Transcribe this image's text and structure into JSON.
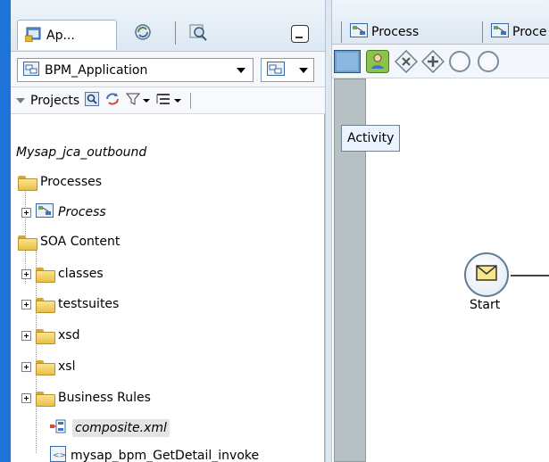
{
  "left_panel": {
    "tabs": {
      "applications_label": "Ap...",
      "icons": [
        "applications-icon",
        "resource-palette-icon",
        "search-resources-icon"
      ]
    },
    "app_selector": {
      "value": "BPM_Application"
    },
    "projects_toolbar": {
      "label": "Projects"
    },
    "tree": {
      "root": "Mysap_jca_outbound",
      "items": [
        {
          "label": "Processes",
          "icon": "folder-icon",
          "italic": false
        },
        {
          "label": "Process",
          "icon": "process-icon",
          "italic": true
        },
        {
          "label": "SOA Content",
          "icon": "folder-icon",
          "italic": false
        },
        {
          "label": "classes",
          "icon": "folder-icon",
          "italic": false
        },
        {
          "label": "testsuites",
          "icon": "folder-icon",
          "italic": false
        },
        {
          "label": "xsd",
          "icon": "folder-icon",
          "italic": false
        },
        {
          "label": "xsl",
          "icon": "folder-icon",
          "italic": false
        },
        {
          "label": "Business Rules",
          "icon": "folder-icon",
          "italic": false
        },
        {
          "label": "composite.xml",
          "icon": "composite-icon",
          "italic": true
        },
        {
          "label": "mysap_bpm_GetDetail_invoke",
          "icon": "wsdl-icon",
          "italic": false
        }
      ]
    }
  },
  "editor": {
    "tabs": [
      "Process",
      "Proce"
    ],
    "palette_icons": [
      "activity-icon",
      "user-task-icon",
      "exclusive-gateway-icon",
      "parallel-gateway-icon",
      "start-event-icon"
    ],
    "tooltip": "Activity",
    "start_event_label": "Start"
  },
  "colors": {
    "left_edge": "#1e73d8",
    "swimlane": "#b7c1c3",
    "tooltip_bg": "#eaf3ff"
  }
}
